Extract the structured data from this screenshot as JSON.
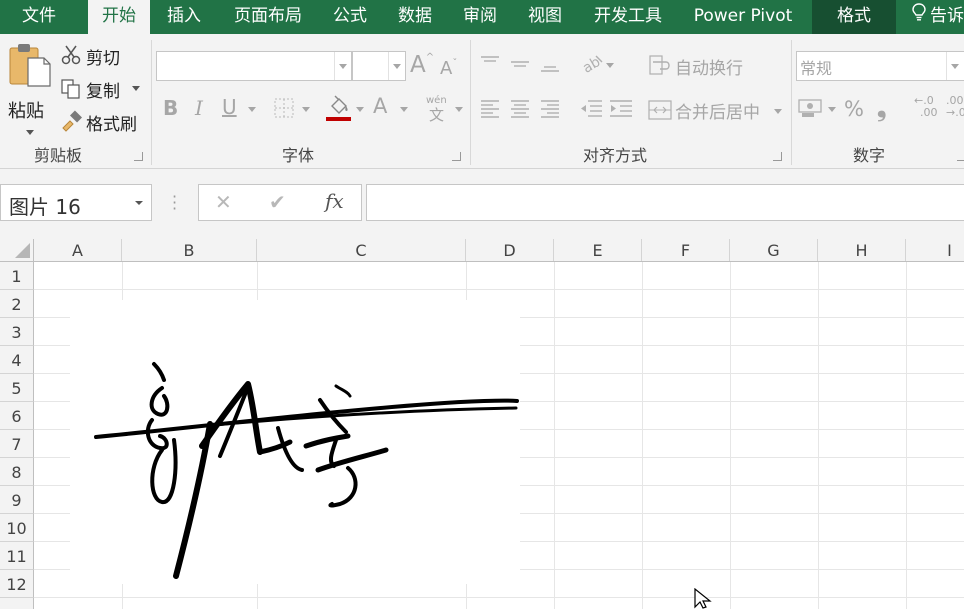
{
  "menu": {
    "tabs": [
      "文件",
      "开始",
      "插入",
      "页面布局",
      "公式",
      "数据",
      "审阅",
      "视图",
      "开发工具",
      "Power Pivot",
      "格式"
    ],
    "tell_me": "告诉"
  },
  "clipboard": {
    "paste": "粘贴",
    "cut": "剪切",
    "copy": "复制",
    "format_painter": "格式刷",
    "label": "剪贴板"
  },
  "font": {
    "label": "字体",
    "grow": "A",
    "shrink": "A",
    "bold": "B",
    "italic": "I",
    "underline": "U",
    "font_color": "A",
    "phonetic_top": "wén",
    "phonetic_bottom": "文",
    "fill_color": "#c00000"
  },
  "alignment": {
    "wrap_text": "自动换行",
    "merge_center": "合并后居中",
    "label": "对齐方式"
  },
  "number": {
    "format": "常规",
    "percent": "%",
    "comma": "❟",
    "inc_decimal_top": "←.0",
    "inc_decimal_bottom": ".00",
    "dec_decimal_top": ".00",
    "dec_decimal_bottom": "→.0",
    "label": "数字"
  },
  "formula_bar": {
    "name_box": "图片 16",
    "cancel": "✕",
    "enter": "✔",
    "fx": "fx",
    "formula": ""
  },
  "sheet": {
    "columns": [
      "A",
      "B",
      "C",
      "D",
      "E",
      "F",
      "G",
      "H",
      "I"
    ],
    "rows": [
      "1",
      "2",
      "3",
      "4",
      "5",
      "6",
      "7",
      "8",
      "9",
      "10",
      "11",
      "12"
    ]
  },
  "colors": {
    "brand": "#217346",
    "format_tab": "#174f31"
  }
}
